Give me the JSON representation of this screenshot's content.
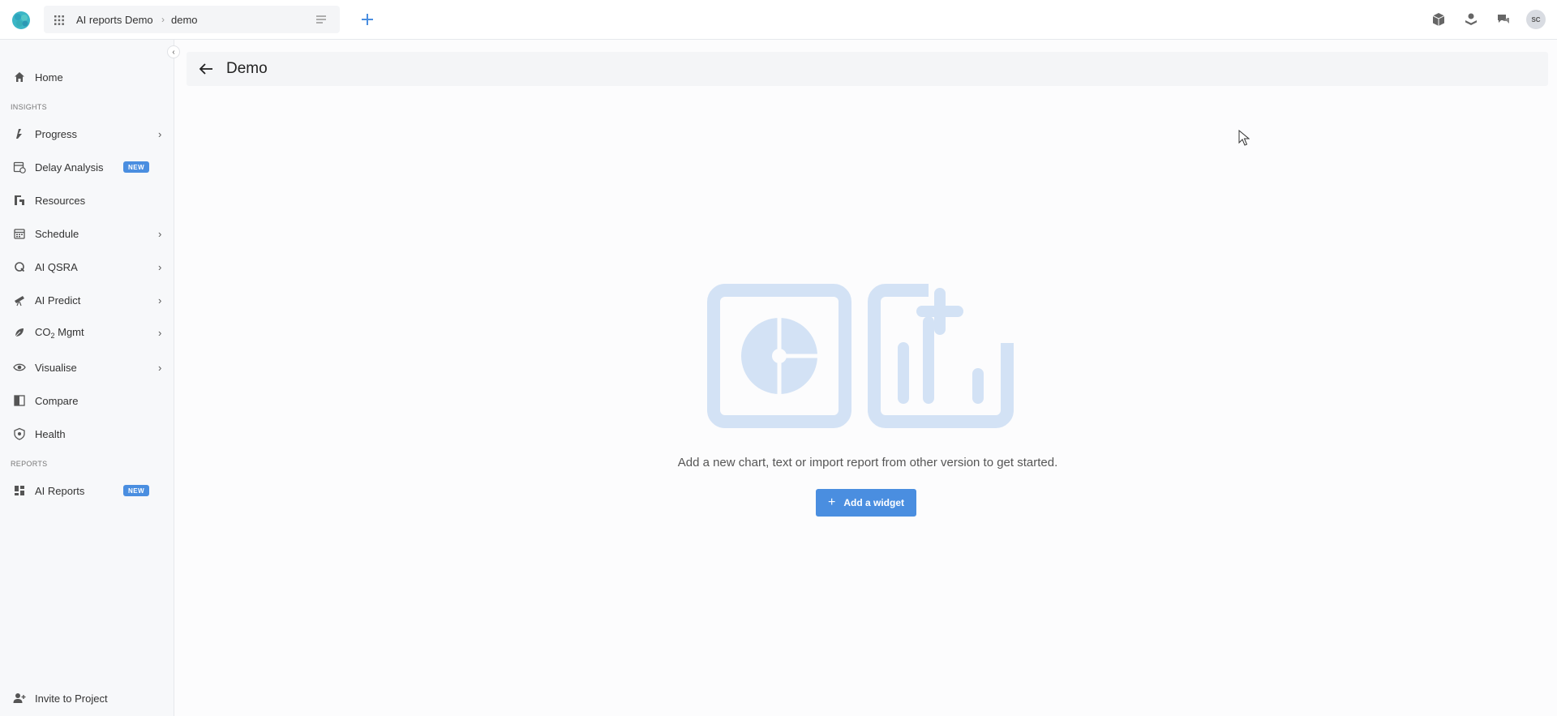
{
  "topbar": {
    "breadcrumb": [
      "AI reports Demo",
      "demo"
    ],
    "breadcrumb_separator": "›",
    "avatar_initials": "SC"
  },
  "sidebar": {
    "collapse_glyph": "‹",
    "home": "Home",
    "section_insights": "INSIGHTS",
    "section_reports": "REPORTS",
    "items": [
      {
        "label": "Progress",
        "icon": "progress-icon",
        "chevron": true
      },
      {
        "label": "Delay Analysis",
        "icon": "calendar-clock-icon",
        "badge": "NEW"
      },
      {
        "label": "Resources",
        "icon": "resources-icon"
      },
      {
        "label": "Schedule",
        "icon": "calendar-icon",
        "chevron": true
      },
      {
        "label": "AI QSRA",
        "icon": "qsra-icon",
        "chevron": true
      },
      {
        "label": "AI Predict",
        "icon": "telescope-icon",
        "chevron": true
      },
      {
        "label": "CO",
        "sub": "2",
        "suffix": " Mgmt",
        "icon": "leaf-icon",
        "chevron": true
      },
      {
        "label": "Visualise",
        "icon": "eye-icon",
        "chevron": true
      },
      {
        "label": "Compare",
        "icon": "compare-icon"
      },
      {
        "label": "Health",
        "icon": "shield-icon"
      }
    ],
    "ai_reports": {
      "label": "AI Reports",
      "badge": "NEW"
    },
    "invite": "Invite to Project"
  },
  "main": {
    "title": "Demo",
    "empty_message": "Add a new chart, text or import report from other version to get started.",
    "add_button": "Add a widget",
    "add_button_plus": "+"
  },
  "colors": {
    "accent": "#4a8ee0",
    "illustration": "#d3e2f5",
    "sidebar_bg": "#f7f8fa"
  }
}
